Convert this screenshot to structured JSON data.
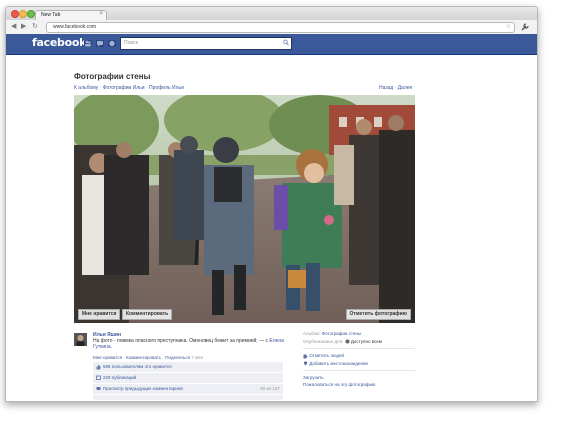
{
  "browser": {
    "tab_title": "New Tab",
    "tab_close": "×",
    "url": "www.facebook.com",
    "back": "◀",
    "forward": "▶",
    "reload": "↻",
    "star": "☆",
    "wrench": "🔧"
  },
  "facebook": {
    "logo": "facebook",
    "search_placeholder": "Поиск",
    "search_icon": "search-icon"
  },
  "page": {
    "title": "Фотографии стены",
    "breadcrumb": [
      "К альбому",
      "Фотографии Ильи",
      "Профиль Ильи"
    ],
    "breadcrumb_sep": "·",
    "nav_back": "Назад",
    "nav_sep": "·",
    "nav_next": "Далее"
  },
  "photo": {
    "like_btn": "Мне нравится",
    "comment_btn": "Комментировать",
    "tag_btn": "Отметить фотографию"
  },
  "post": {
    "author": "Илья Яшин",
    "caption_text": "На фото - поимка опасного преступника. Омоновец бежит за премией; — с ",
    "caption_link": "Еленa Гуткина.",
    "actions": [
      "Мне нравится",
      "Комментировать",
      "Поделиться"
    ],
    "actions_sep": "·",
    "time": "7 мая",
    "likes": "598 пользователям это нравится",
    "shares": "229 публикаций",
    "view_prev": "Просмотр предыдущих комментариев",
    "comment_count": "50 из 107"
  },
  "sidebar": {
    "album_label": "Альбом:",
    "album_name": "Фотографии стены",
    "published_label": "Опубликовано для:",
    "published_value": "Доступно всем",
    "tag_people": "Отметить людей",
    "add_location": "Добавить местонахождение",
    "download": "Загрузить",
    "report": "Пожаловаться на эту фотографию"
  }
}
